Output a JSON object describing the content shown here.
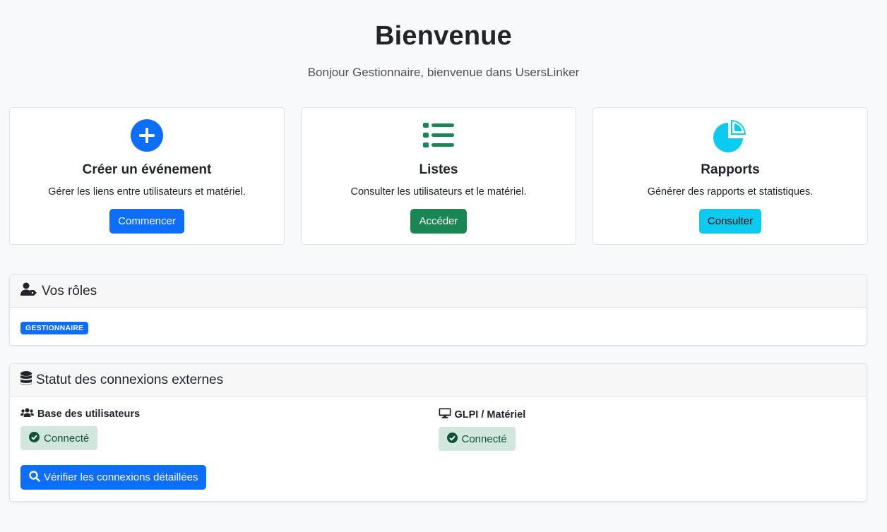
{
  "header": {
    "title": "Bienvenue",
    "subtitle": "Bonjour Gestionnaire, bienvenue dans UsersLinker"
  },
  "cards": [
    {
      "icon": "plus-circle-icon",
      "title": "Créer un événement",
      "text": "Gérer les liens entre utilisateurs et matériel.",
      "button": "Commencer",
      "color": "#0d6efd"
    },
    {
      "icon": "list-icon",
      "title": "Listes",
      "text": "Consulter les utilisateurs et le matériel.",
      "button": "Accéder",
      "color": "#198754"
    },
    {
      "icon": "pie-chart-icon",
      "title": "Rapports",
      "text": "Générer des rapports et statistiques.",
      "button": "Consulter",
      "color": "#0dcaf0"
    }
  ],
  "roles": {
    "title": "Vos rôles",
    "badges": [
      "GESTIONNAIRE"
    ]
  },
  "status": {
    "title": "Statut des connexions externes",
    "users_label": "Base des utilisateurs",
    "users_status": "Connecté",
    "glpi_label": "GLPI / Matériel",
    "glpi_status": "Connecté",
    "verify_button": "Vérifier les connexions détaillées"
  }
}
